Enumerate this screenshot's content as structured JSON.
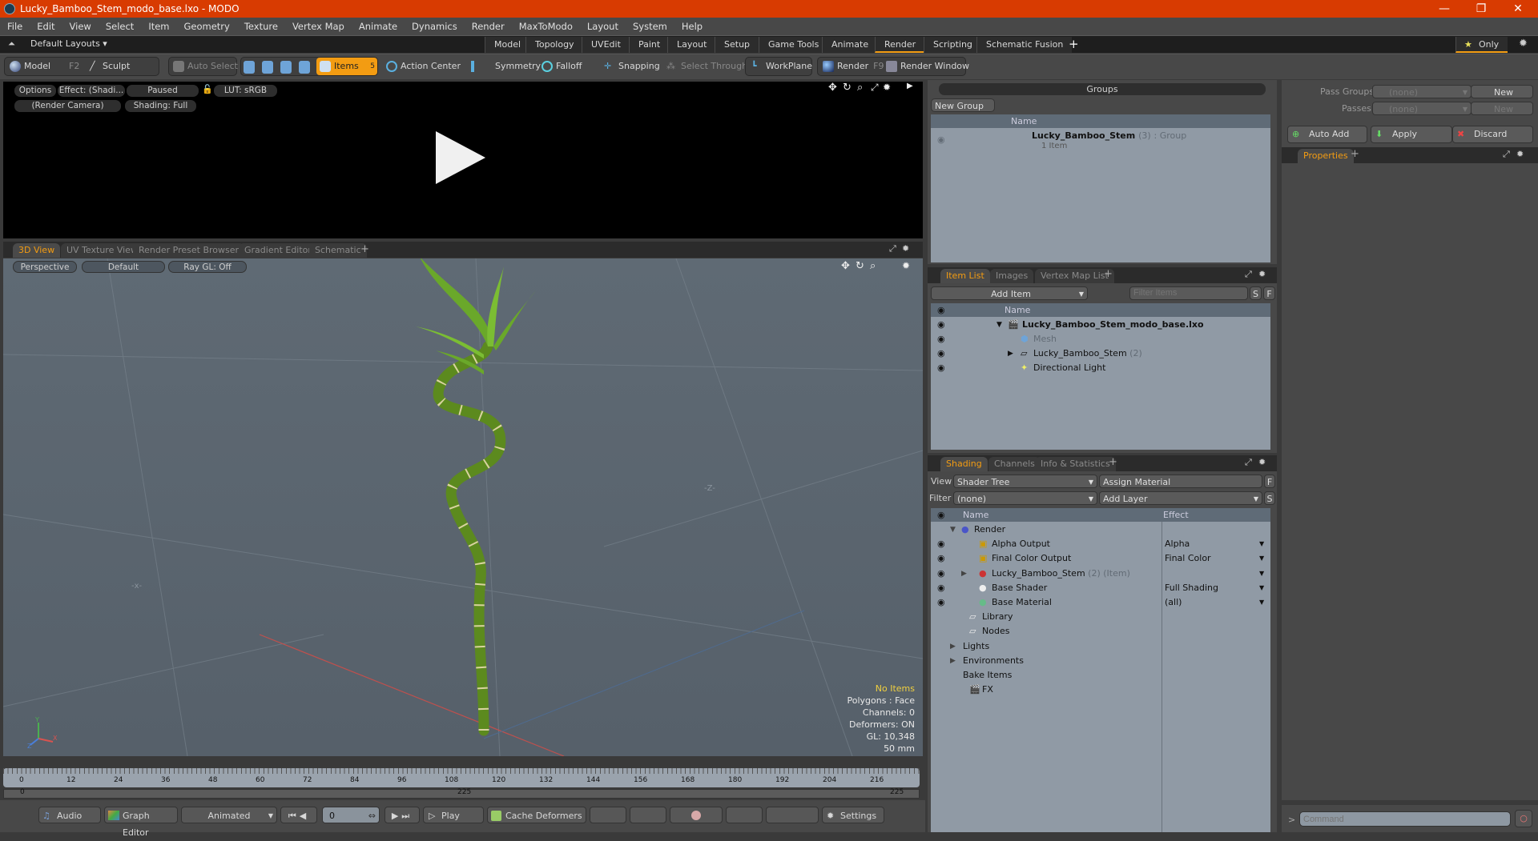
{
  "window": {
    "title": "Lucky_Bamboo_Stem_modo_base.lxo - MODO",
    "minimize": "—",
    "restore": "❐",
    "close": "✕"
  },
  "menu": [
    "File",
    "Edit",
    "View",
    "Select",
    "Item",
    "Geometry",
    "Texture",
    "Vertex Map",
    "Animate",
    "Dynamics",
    "Render",
    "MaxToModo",
    "Layout",
    "System",
    "Help"
  ],
  "layouts": {
    "label": "Default Layouts ▾",
    "tabs": [
      "Model",
      "Topology",
      "UVEdit",
      "Paint",
      "Layout",
      "Setup",
      "Game Tools",
      "Animate",
      "Render",
      "Scripting",
      "Schematic Fusion"
    ],
    "active": "Render",
    "add": "+",
    "only": "Only"
  },
  "toolbar": {
    "model": "Model",
    "model_key": "F2",
    "sculpt": "Sculpt",
    "auto_select": "Auto Select",
    "items": "Items",
    "items_count": "5",
    "action_center": "Action Center",
    "symmetry": "Symmetry",
    "falloff": "Falloff",
    "snapping": "Snapping",
    "select_through": "Select Through",
    "workplane": "WorkPlane",
    "render": "Render",
    "render_key": "F9",
    "render_window": "Render Window"
  },
  "render_view": {
    "options": "Options",
    "effect": "Effect: (Shadi...",
    "paused": "Paused",
    "lut": "LUT: sRGB",
    "camera": "(Render Camera)",
    "shading": "Shading: Full"
  },
  "viewport": {
    "tabs": [
      "3D View",
      "UV Texture View",
      "Render Preset Browser",
      "Gradient Editor",
      "Schematic"
    ],
    "active": "3D View",
    "add": "+",
    "perspective": "Perspective",
    "default": "Default",
    "raygl": "Ray GL: Off",
    "stats": {
      "items": "No Items",
      "polygons": "Polygons : Face",
      "channels": "Channels: 0",
      "deformers": "Deformers: ON",
      "gl": "GL: 10,348",
      "scale": "50 mm"
    },
    "axis": {
      "x": "X",
      "y": "Y",
      "z": "Z"
    }
  },
  "timeline": {
    "ticks": [
      "0",
      "12",
      "24",
      "36",
      "48",
      "60",
      "72",
      "84",
      "96",
      "108",
      "120",
      "132",
      "144",
      "156",
      "168",
      "180",
      "192",
      "204",
      "216"
    ],
    "range_start": "0",
    "range_mid": "225",
    "range_end": "225"
  },
  "bottom": {
    "audio": "Audio",
    "graph_editor": "Graph Editor",
    "animated": "Animated",
    "frame": "0",
    "play": "Play",
    "cache_deformers": "Cache Deformers",
    "settings": "Settings"
  },
  "groups": {
    "title": "Groups",
    "new_group": "New Group",
    "col_name": "Name",
    "row": {
      "name": "Lucky_Bamboo_Stem",
      "count": "(3)",
      "type": ": Group",
      "sub": "1 Item"
    }
  },
  "passes": {
    "pass_groups_label": "Pass Groups",
    "passes_label": "Passes",
    "pass_groups_value": "(none)",
    "passes_value": "(none)",
    "new1": "New",
    "new2": "New",
    "auto_add": "Auto Add",
    "apply": "Apply",
    "discard": "Discard",
    "properties_tab": "Properties",
    "add": "+"
  },
  "item_list": {
    "tabs": [
      "Item List",
      "Images",
      "Vertex Map List"
    ],
    "active": "Item List",
    "add": "+",
    "add_item": "Add Item",
    "filter_placeholder": "Filter Items",
    "s": "S",
    "f": "F",
    "col_name": "Name",
    "rows": [
      {
        "name": "Lucky_Bamboo_Stem_modo_base.lxo",
        "extra": ""
      },
      {
        "name": "Mesh",
        "extra": ""
      },
      {
        "name": "Lucky_Bamboo_Stem",
        "extra": "(2)"
      },
      {
        "name": "Directional Light",
        "extra": ""
      }
    ]
  },
  "shading": {
    "tabs": [
      "Shading",
      "Channels",
      "Info & Statistics"
    ],
    "active": "Shading",
    "add": "+",
    "view_label": "View",
    "view_value": "Shader Tree",
    "assign_material": "Assign Material",
    "filter_label": "Filter",
    "filter_value": "(none)",
    "add_layer": "Add Layer",
    "f": "F",
    "s": "S",
    "col_name": "Name",
    "col_effect": "Effect",
    "rows": [
      {
        "name": "Render",
        "extra": "",
        "effect": ""
      },
      {
        "name": "Alpha Output",
        "extra": "",
        "effect": "Alpha"
      },
      {
        "name": "Final Color Output",
        "extra": "",
        "effect": "Final Color"
      },
      {
        "name": "Lucky_Bamboo_Stem",
        "extra": "(2) (Item)",
        "effect": ""
      },
      {
        "name": "Base Shader",
        "extra": "",
        "effect": "Full Shading"
      },
      {
        "name": "Base Material",
        "extra": "",
        "effect": "(all)"
      },
      {
        "name": "Library",
        "extra": "",
        "effect": ""
      },
      {
        "name": "Nodes",
        "extra": "",
        "effect": ""
      },
      {
        "name": "Lights",
        "extra": "",
        "effect": ""
      },
      {
        "name": "Environments",
        "extra": "",
        "effect": ""
      },
      {
        "name": "Bake Items",
        "extra": "",
        "effect": ""
      },
      {
        "name": "FX",
        "extra": "",
        "effect": ""
      }
    ]
  },
  "command": {
    "prompt": ">",
    "placeholder": "Command"
  }
}
